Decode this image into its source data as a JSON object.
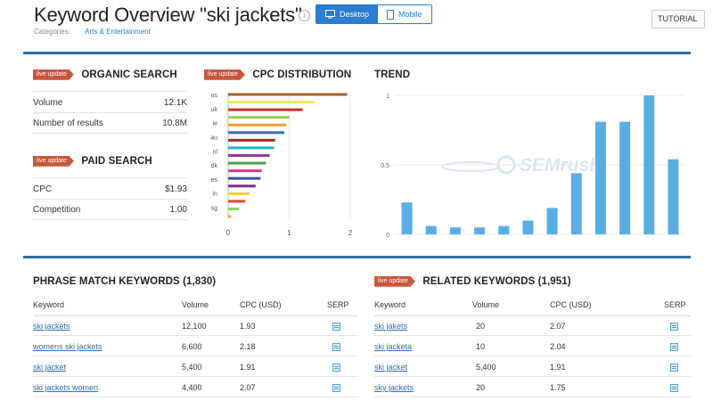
{
  "header": {
    "title": "Keyword Overview \"ski jackets\"",
    "info_icon": "i",
    "device": {
      "desktop": "Desktop",
      "mobile": "Mobile",
      "selected": "Desktop"
    },
    "categories_label": "Categories:",
    "category": "Arts & Entertainment",
    "tutorial": "TUTORIAL"
  },
  "badge": "live update",
  "organic": {
    "title": "ORGANIC SEARCH",
    "rows": [
      {
        "label": "Volume",
        "value": "12.1K"
      },
      {
        "label": "Number of results",
        "value": "10.8M"
      }
    ]
  },
  "paid": {
    "title": "PAID SEARCH",
    "rows": [
      {
        "label": "CPC",
        "value": "$1.93"
      },
      {
        "label": "Competition",
        "value": "1.00"
      }
    ]
  },
  "cpc": {
    "title": "CPC DISTRIBUTION",
    "labels": [
      "us",
      "uk",
      "ie",
      "au",
      "nl",
      "dk",
      "es",
      "in",
      "sg"
    ],
    "x_ticks": [
      "0",
      "1",
      "2"
    ]
  },
  "trend": {
    "title": "TREND",
    "y_ticks": [
      "1",
      "0.5",
      "0"
    ],
    "watermark": "SEMrush"
  },
  "chart_data": [
    {
      "type": "bar",
      "orientation": "horizontal",
      "title": "CPC DISTRIBUTION",
      "xlim": [
        0,
        2
      ],
      "values": [
        1.95,
        1.42,
        1.22,
        1.0,
        0.95,
        0.92,
        0.77,
        0.75,
        0.68,
        0.62,
        0.55,
        0.53,
        0.45,
        0.35,
        0.28,
        0.18,
        0.05
      ],
      "colors": [
        "#a6622e",
        "#f3e85a",
        "#c8302f",
        "#9ccf4f",
        "#f19a33",
        "#3c6db4",
        "#9f2b27",
        "#21b7c4",
        "#8e3a9d",
        "#48a04a",
        "#d63a84",
        "#3d4ea6",
        "#7d2f8d",
        "#ead03c",
        "#d6493c",
        "#8bd06a",
        "#f1a23b",
        "#2f78b8"
      ]
    },
    {
      "type": "bar",
      "title": "TREND",
      "ylim": [
        0,
        1
      ],
      "values": [
        0.23,
        0.06,
        0.05,
        0.05,
        0.06,
        0.1,
        0.19,
        0.44,
        0.81,
        0.81,
        1.0,
        0.54
      ],
      "color": "#5aade4"
    }
  ],
  "phrase": {
    "title": "PHRASE MATCH KEYWORDS (1,830)",
    "headers": {
      "keyword": "Keyword",
      "volume": "Volume",
      "cpc": "CPC (USD)",
      "serp": "SERP"
    },
    "rows": [
      {
        "keyword": "ski jackets",
        "volume": "12,100",
        "cpc": "1.93"
      },
      {
        "keyword": "womens ski jackets",
        "volume": "6,600",
        "cpc": "2.18"
      },
      {
        "keyword": "ski jacket",
        "volume": "5,400",
        "cpc": "1.91"
      },
      {
        "keyword": "ski jackets women",
        "volume": "4,400",
        "cpc": "2.07"
      }
    ]
  },
  "related": {
    "title": "RELATED KEYWORDS (1,951)",
    "headers": {
      "keyword": "Keyword",
      "volume": "Volume",
      "cpc": "CPC (USD)",
      "serp": "SERP"
    },
    "rows": [
      {
        "keyword": "ski jakets",
        "volume": "20",
        "cpc": "2.07"
      },
      {
        "keyword": "ski jacketa",
        "volume": "10",
        "cpc": "2.04"
      },
      {
        "keyword": "ski jacket",
        "volume": "5,400",
        "cpc": "1.91"
      },
      {
        "keyword": "sky jackets",
        "volume": "20",
        "cpc": "1.75"
      }
    ]
  }
}
